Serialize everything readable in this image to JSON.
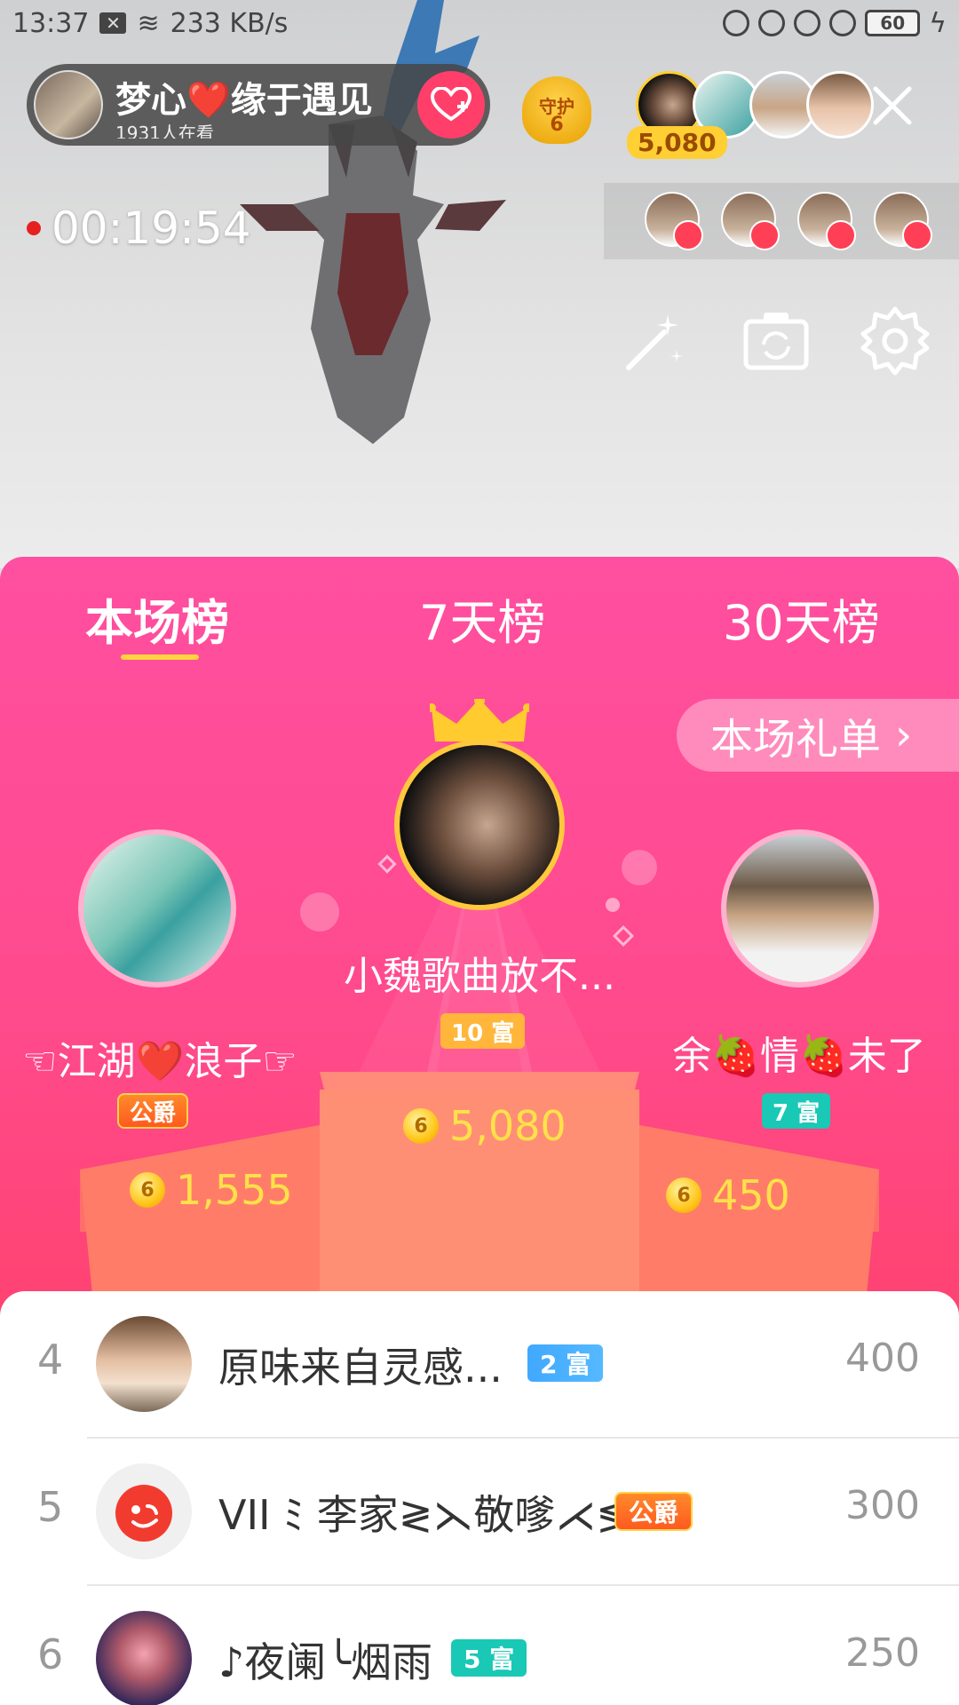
{
  "status_bar": {
    "time": "13:37",
    "speed": "233 KB/s",
    "battery": "60"
  },
  "host": {
    "name": "梦心❤️缘于遇见",
    "viewers": "1931人在看"
  },
  "guard": {
    "label": "守护",
    "count": "6"
  },
  "top_viewer_badge": "5,080",
  "timer": "00:19:54",
  "tabs": [
    "本场榜",
    "7天榜",
    "30天榜"
  ],
  "gift_list_label": "本场礼单",
  "podium": {
    "first": {
      "name": "小魏歌曲放不...",
      "level": "10 富",
      "coins": "5,080"
    },
    "second": {
      "name": "☜江湖❤️浪子☞",
      "level": "公爵",
      "coins": "1,555"
    },
    "third": {
      "name": "余🍓情🍓未了",
      "level": "7 富",
      "coins": "450"
    }
  },
  "list": [
    {
      "rank": "4",
      "name": "原味来自灵感...",
      "badge": "2 富",
      "score": "400"
    },
    {
      "rank": "5",
      "name": "VII ﾐ 李家≷⋋敬嗲⋌≶",
      "badge": "公爵",
      "score": "300"
    },
    {
      "rank": "6",
      "name": "♪夜阑╰烟雨",
      "badge": "5 富",
      "score": "250"
    }
  ],
  "colors": {
    "panel_pink": "#ff4fa0",
    "panel_red": "#ff3f55",
    "gold": "#ffc83d",
    "coin_text": "#ffe14a"
  }
}
